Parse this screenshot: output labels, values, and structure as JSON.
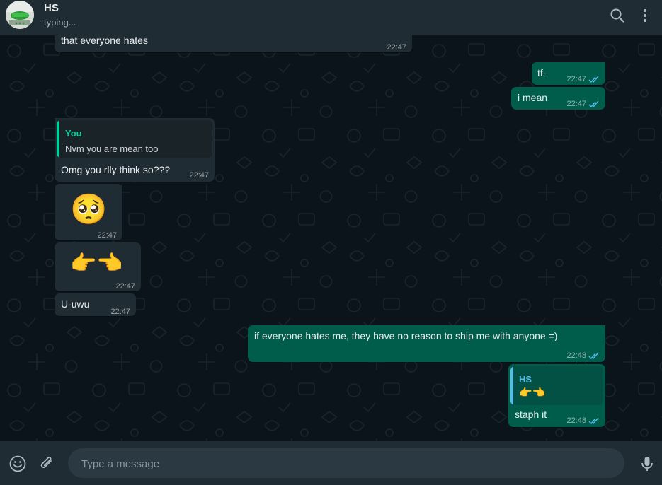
{
  "header": {
    "contact_name": "HS",
    "status": "typing..."
  },
  "composer": {
    "placeholder": "Type a message"
  },
  "colors": {
    "header_bg": "#202c33",
    "chat_bg": "#0b141a",
    "incoming_bubble": "#202c33",
    "outgoing_bubble": "#005c4b",
    "read_ticks": "#53bdeb",
    "quote_you": "#06cf9c",
    "quote_hs": "#53bdeb"
  },
  "messages": [
    {
      "direction": "in",
      "text": "that everyone hates",
      "time": "22:47"
    },
    {
      "direction": "out",
      "text": "tf-",
      "time": "22:47",
      "status": "read"
    },
    {
      "direction": "out",
      "text": "i mean",
      "time": "22:47",
      "status": "read"
    },
    {
      "direction": "in",
      "quote": {
        "author": "You",
        "text": "Nvm you are mean too"
      },
      "text": "Omg you rlly think so???",
      "time": "22:47"
    },
    {
      "direction": "in",
      "emoji": "🥺",
      "time": "22:47"
    },
    {
      "direction": "in",
      "emoji": "👉👈",
      "time": "22:47"
    },
    {
      "direction": "in",
      "text": "U-uwu",
      "time": "22:47"
    },
    {
      "direction": "out",
      "text": "if everyone hates me, they have no reason to ship me with anyone =)",
      "time": "22:48",
      "status": "read"
    },
    {
      "direction": "out",
      "quote": {
        "author": "HS",
        "text": "👉👈"
      },
      "text": "staph it",
      "time": "22:48",
      "status": "read"
    }
  ],
  "icons": {
    "search": "search-icon",
    "menu": "menu-icon",
    "emoji": "emoji-icon",
    "attach": "paperclip-icon",
    "mic": "microphone-icon"
  }
}
